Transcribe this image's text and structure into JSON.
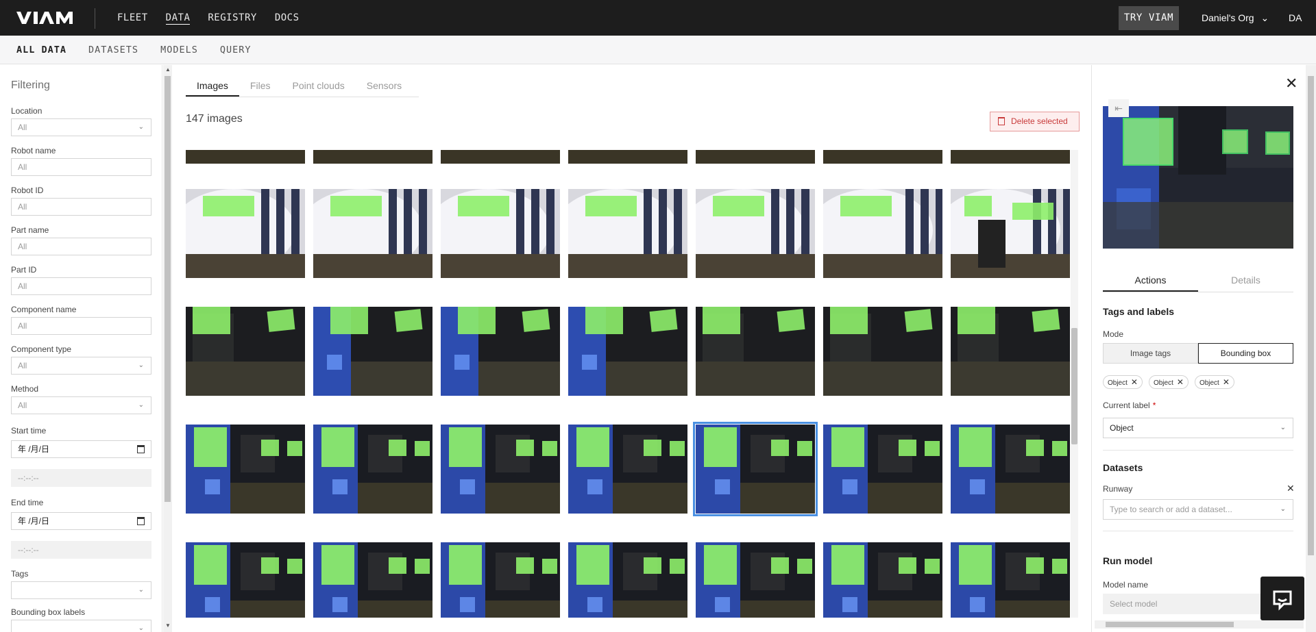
{
  "brand": {
    "logo_text": "VIAM"
  },
  "topnav": {
    "items": [
      {
        "label": "FLEET"
      },
      {
        "label": "DATA"
      },
      {
        "label": "REGISTRY"
      },
      {
        "label": "DOCS"
      }
    ],
    "try_label": "TRY VIAM",
    "org_name": "Daniel's Org",
    "user_initials": "DA"
  },
  "subnav": {
    "items": [
      {
        "label": "ALL DATA"
      },
      {
        "label": "DATASETS"
      },
      {
        "label": "MODELS"
      },
      {
        "label": "QUERY"
      }
    ]
  },
  "filter": {
    "title": "Filtering",
    "location": {
      "label": "Location",
      "value": "All"
    },
    "robot_name": {
      "label": "Robot name",
      "placeholder": "All"
    },
    "robot_id": {
      "label": "Robot ID",
      "placeholder": "All"
    },
    "part_name": {
      "label": "Part name",
      "placeholder": "All"
    },
    "part_id": {
      "label": "Part ID",
      "placeholder": "All"
    },
    "component_name": {
      "label": "Component name",
      "placeholder": "All"
    },
    "component_type": {
      "label": "Component type",
      "value": "All"
    },
    "method": {
      "label": "Method",
      "value": "All"
    },
    "start_time": {
      "label": "Start time",
      "date": "年 /月/日",
      "time": "--:--:--"
    },
    "end_time": {
      "label": "End time",
      "date": "年 /月/日",
      "time": "--:--:--"
    },
    "tags": {
      "label": "Tags",
      "value": ""
    },
    "bbox_labels": {
      "label": "Bounding box labels"
    }
  },
  "main": {
    "tabs": [
      {
        "label": "Images"
      },
      {
        "label": "Files"
      },
      {
        "label": "Point clouds"
      },
      {
        "label": "Sensors"
      }
    ],
    "count_text": "147 images",
    "delete_label": "Delete selected"
  },
  "right": {
    "collapse_icon": "⇤",
    "tabs": [
      {
        "label": "Actions"
      },
      {
        "label": "Details"
      }
    ],
    "tags_title": "Tags and labels",
    "mode_label": "Mode",
    "mode_options": [
      {
        "label": "Image tags"
      },
      {
        "label": "Bounding box"
      }
    ],
    "chips": [
      {
        "label": "Object"
      },
      {
        "label": "Object"
      },
      {
        "label": "Object"
      }
    ],
    "current_label_label": "Current label",
    "current_label_required": "*",
    "current_label_value": "Object",
    "datasets_title": "Datasets",
    "dataset_name": "Runway",
    "dataset_placeholder": "Type to search or add a dataset...",
    "run_model_title": "Run model",
    "model_name_label": "Model name",
    "model_placeholder": "Select model"
  }
}
